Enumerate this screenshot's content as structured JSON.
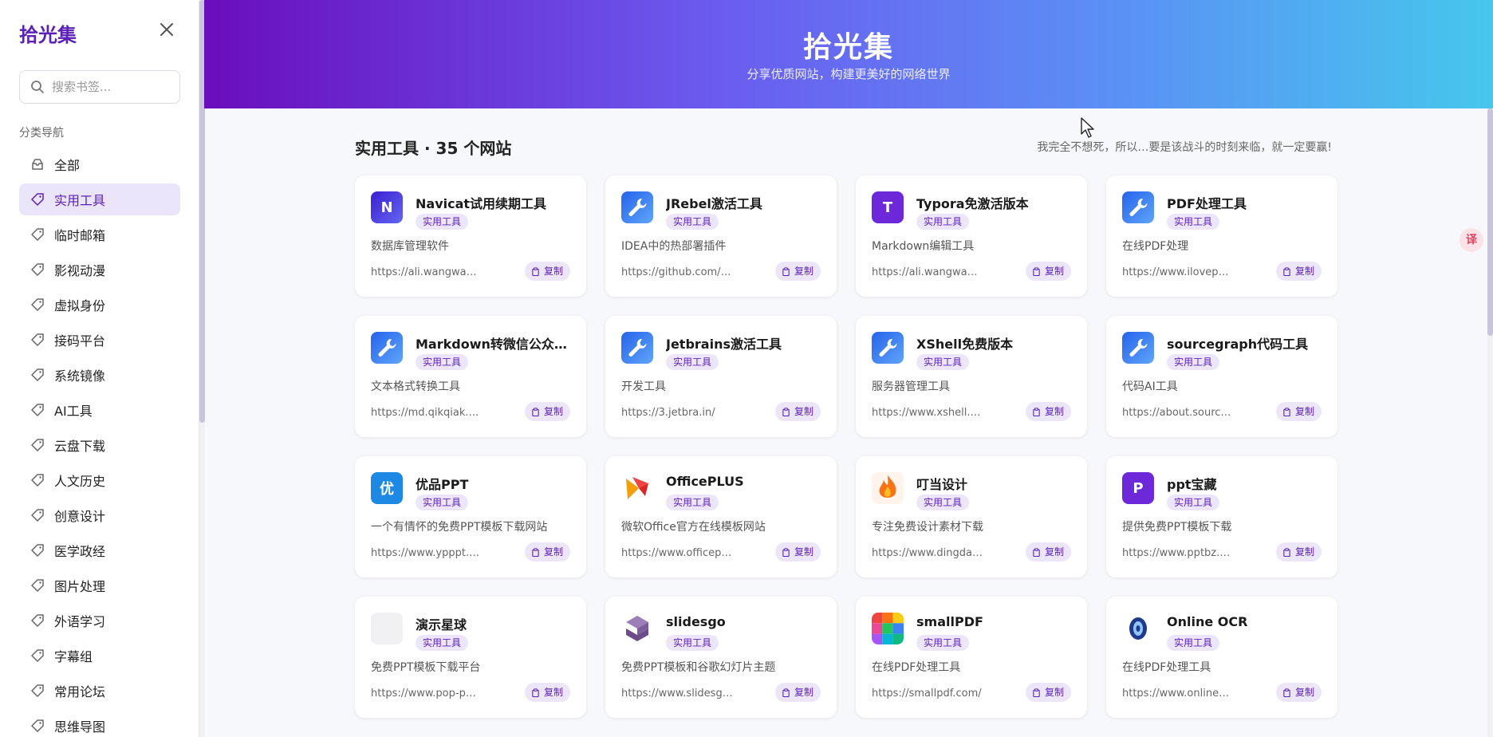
{
  "sidebar": {
    "brand": "拾光集",
    "search_placeholder": "搜索书签...",
    "nav_title": "分类导航",
    "items": [
      {
        "label": "全部",
        "icon": "inbox-icon"
      },
      {
        "label": "实用工具",
        "icon": "tag-icon",
        "active": true
      },
      {
        "label": "临时邮箱",
        "icon": "tag-icon"
      },
      {
        "label": "影视动漫",
        "icon": "tag-icon"
      },
      {
        "label": "虚拟身份",
        "icon": "tag-icon"
      },
      {
        "label": "接码平台",
        "icon": "tag-icon"
      },
      {
        "label": "系统镜像",
        "icon": "tag-icon"
      },
      {
        "label": "AI工具",
        "icon": "tag-icon"
      },
      {
        "label": "云盘下载",
        "icon": "tag-icon"
      },
      {
        "label": "人文历史",
        "icon": "tag-icon"
      },
      {
        "label": "创意设计",
        "icon": "tag-icon"
      },
      {
        "label": "医学政经",
        "icon": "tag-icon"
      },
      {
        "label": "图片处理",
        "icon": "tag-icon"
      },
      {
        "label": "外语学习",
        "icon": "tag-icon"
      },
      {
        "label": "字幕组",
        "icon": "tag-icon"
      },
      {
        "label": "常用论坛",
        "icon": "tag-icon"
      },
      {
        "label": "思维导图",
        "icon": "tag-icon"
      }
    ]
  },
  "hero": {
    "title": "拾光集",
    "subtitle": "分享优质网站，构建更美好的网络世界"
  },
  "section": {
    "title": "实用工具 · 35 个网站",
    "motto": "我完全不想死，所以…要是该战斗的时刻来临，就一定要赢!"
  },
  "copy_label": "复制",
  "translate_badge": "译",
  "cards": [
    {
      "name": "Navicat试用续期工具",
      "tag": "实用工具",
      "desc": "数据库管理软件",
      "url": "https://ali.wangwangit.com/",
      "logo_text": "N",
      "logo": "letter",
      "color": "#4f46e5"
    },
    {
      "name": "JRebel激活工具",
      "tag": "实用工具",
      "desc": "IDEA中的热部署插件",
      "url": "https://github.com/ilanyu/",
      "logo": "wrench",
      "color": "#3b82f6"
    },
    {
      "name": "Typora免激活版本",
      "tag": "实用工具",
      "desc": "Markdown编辑工具",
      "url": "https://ali.wangwangit.com/",
      "logo_text": "T",
      "logo": "letter",
      "color": "#6d28d9"
    },
    {
      "name": "PDF处理工具",
      "tag": "实用工具",
      "desc": "在线PDF处理",
      "url": "https://www.ilovepdf.com/",
      "logo": "wrench",
      "color": "#3b82f6"
    },
    {
      "name": "Markdown转微信公众号排版",
      "tag": "实用工具",
      "desc": "文本格式转换工具",
      "url": "https://md.qikqiak.com/",
      "logo": "wrench",
      "color": "#3b82f6"
    },
    {
      "name": "Jetbrains激活工具",
      "tag": "实用工具",
      "desc": "开发工具",
      "url": "https://3.jetbra.in/",
      "logo": "wrench",
      "color": "#3b82f6"
    },
    {
      "name": "XShell免费版本",
      "tag": "实用工具",
      "desc": "服务器管理工具",
      "url": "https://www.xshell.com/",
      "logo": "wrench",
      "color": "#3b82f6"
    },
    {
      "name": "sourcegraph代码工具",
      "tag": "实用工具",
      "desc": "代码AI工具",
      "url": "https://about.sourcegraph.com/",
      "logo": "wrench",
      "color": "#3b82f6"
    },
    {
      "name": "优品PPT",
      "tag": "实用工具",
      "desc": "一个有情怀的免费PPT模板下载网站",
      "url": "https://www.ypppt.com/",
      "logo_text": "优",
      "logo": "letter",
      "color": "#1e88e5"
    },
    {
      "name": "OfficePLUS",
      "tag": "实用工具",
      "desc": "微软Office官方在线模板网站",
      "url": "https://www.officeplus.cn/",
      "logo": "bird",
      "color": "#ef4444"
    },
    {
      "name": "叮当设计",
      "tag": "实用工具",
      "desc": "专注免费设计素材下载",
      "url": "https://www.dingdangsheji.com/",
      "logo": "flame",
      "color": "#f97316"
    },
    {
      "name": "ppt宝藏",
      "tag": "实用工具",
      "desc": "提供免费PPT模板下载",
      "url": "https://www.pptbz.com/",
      "logo_text": "P",
      "logo": "letter",
      "color": "#6d28d9"
    },
    {
      "name": "演示星球",
      "tag": "实用工具",
      "desc": "免费PPT模板下载平台",
      "url": "https://www.pop-ppt.com/",
      "logo": "blank",
      "color": "#f1f1f3"
    },
    {
      "name": "slidesgo",
      "tag": "实用工具",
      "desc": "免费PPT模板和谷歌幻灯片主题",
      "url": "https://www.slidesgo.com/",
      "logo": "slidesgo",
      "color": "#7c5c9c"
    },
    {
      "name": "smallPDF",
      "tag": "实用工具",
      "desc": "在线PDF处理工具",
      "url": "https://smallpdf.com/",
      "logo": "tiles",
      "color": "#ef4444"
    },
    {
      "name": "Online OCR",
      "tag": "实用工具",
      "desc": "在线PDF处理工具",
      "url": "https://www.onlineocr.net/",
      "logo": "ocr",
      "color": "#1e3a8a"
    }
  ]
}
